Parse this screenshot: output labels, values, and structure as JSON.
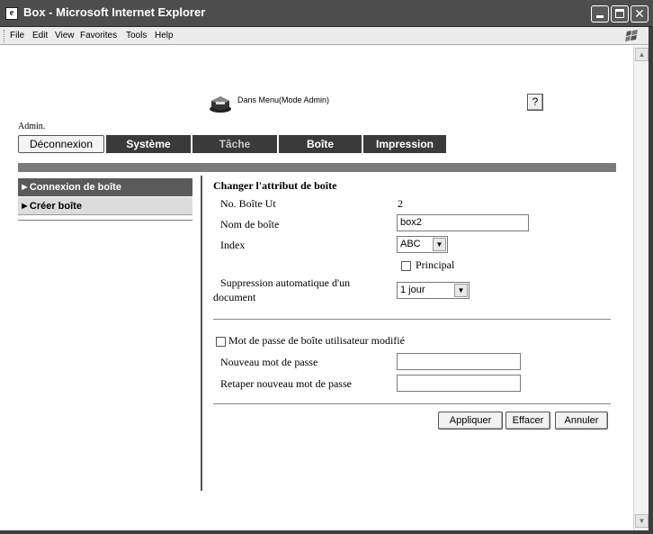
{
  "window": {
    "title": "Box - Microsoft Internet Explorer"
  },
  "menubar": {
    "items": [
      "File",
      "Edit",
      "View",
      "Favorites",
      "Tools",
      "Help"
    ]
  },
  "header": {
    "mode_label": "Dans Menu(Mode Admin)",
    "help_label": "?",
    "user_label": "Admin."
  },
  "nav": {
    "logout_label": "Déconnexion",
    "tabs": [
      "Système",
      "Tâche",
      "Boîte",
      "Impression"
    ]
  },
  "sidebar": {
    "items": [
      "►Connexion de boîte",
      "►Créer boîte"
    ]
  },
  "form": {
    "title": "Changer l'attribut de boîte",
    "box_no_label": "No. Boîte Ut",
    "box_no_value": "2",
    "box_name_label": "Nom de boîte",
    "box_name_value": "box2",
    "index_label": "Index",
    "index_value": "ABC",
    "principal_label": "Principal",
    "auto_delete_label_line1": "Suppression automatique d'un",
    "auto_delete_label_line2": "document",
    "auto_delete_value": "1 jour",
    "password_changed_label": "Mot de passe de boîte utilisateur modifié",
    "new_password_label": "Nouveau mot de passe",
    "new_password_value": "",
    "retype_password_label": "Retaper nouveau mot de passe",
    "retype_password_value": "",
    "apply_label": "Appliquer",
    "clear_label": "Effacer",
    "cancel_label": "Annuler"
  },
  "icons": {
    "app": "ie-page-icon",
    "device": "printer-icon",
    "dropdown": "chevron-down-icon"
  }
}
